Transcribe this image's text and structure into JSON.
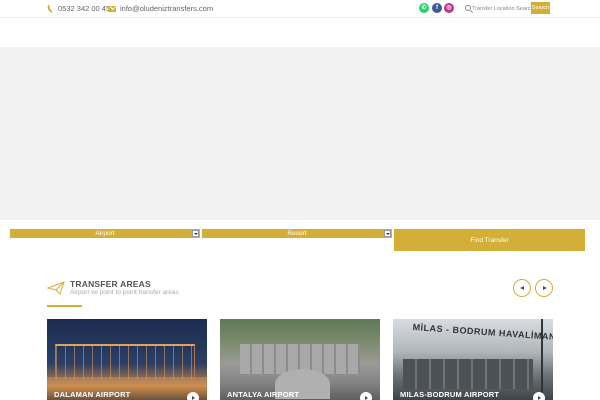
{
  "topbar": {
    "phone": "0532 342 00 45",
    "email": "info@oludeniztransfers.com",
    "social": [
      {
        "icon": "whatsapp-icon",
        "color": "#25d366"
      },
      {
        "icon": "facebook-icon",
        "color": "#3b5998"
      },
      {
        "icon": "instagram-icon",
        "color": "#c13584"
      }
    ],
    "search_placeholder": "Transfer Location Search",
    "search_button": "Search"
  },
  "booking": {
    "from_select": "Airport",
    "to_select": "Resort",
    "find_button": "Find Transfer"
  },
  "areas": {
    "title": "TRANSFER AREAS",
    "subtitle": "Airport ve point to point transfer areas",
    "cards": [
      {
        "title": "DALAMAN AIRPORT"
      },
      {
        "title": "ANTALYA AIRPORT"
      },
      {
        "title": "MILAS-BODRUM AIRPORT",
        "photo_sign": "MİLAS - BODRUM HAVALİMANI"
      }
    ]
  },
  "colors": {
    "accent": "#d4af37",
    "hero_bg": "#f2f2f2"
  }
}
